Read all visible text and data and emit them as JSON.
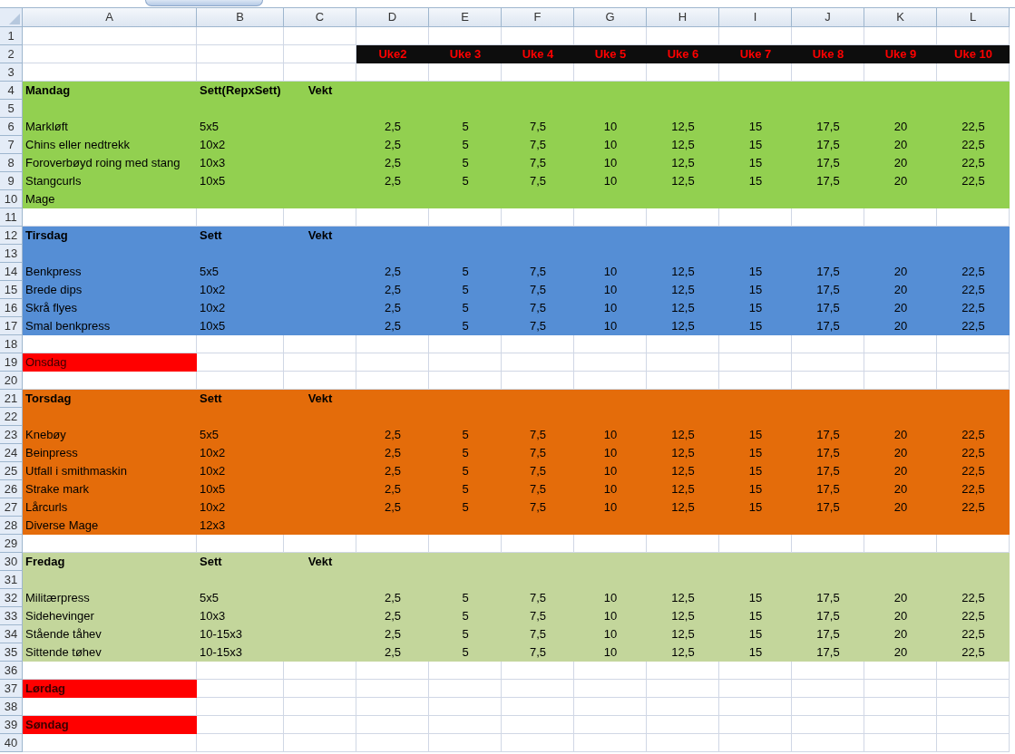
{
  "columns": [
    "A",
    "B",
    "C",
    "D",
    "E",
    "F",
    "G",
    "H",
    "I",
    "J",
    "K",
    "L"
  ],
  "rows": [
    {
      "number": "1",
      "kind": "plain"
    },
    {
      "number": "2",
      "kind": "week_header",
      "weeks": [
        "Uke2",
        "Uke 3",
        "Uke 4",
        "Uke 5",
        "Uke 6",
        "Uke 7",
        "Uke 8",
        "Uke 9",
        "Uke 10"
      ]
    },
    {
      "number": "3",
      "kind": "plain"
    },
    {
      "number": "4",
      "kind": "section",
      "color": "#92d050",
      "bold": true,
      "a": "Mandag",
      "b": "Sett(RepxSett)",
      "c": "Vekt"
    },
    {
      "number": "5",
      "kind": "section",
      "color": "#92d050"
    },
    {
      "number": "6",
      "kind": "section",
      "color": "#92d050",
      "bold": false,
      "a": "Markløft",
      "b": "5x5",
      "weights": [
        "2,5",
        "5",
        "7,5",
        "10",
        "12,5",
        "15",
        "17,5",
        "20",
        "22,5"
      ]
    },
    {
      "number": "7",
      "kind": "section",
      "color": "#92d050",
      "bold": false,
      "a": "Chins eller nedtrekk",
      "b": "10x2",
      "weights": [
        "2,5",
        "5",
        "7,5",
        "10",
        "12,5",
        "15",
        "17,5",
        "20",
        "22,5"
      ]
    },
    {
      "number": "8",
      "kind": "section",
      "color": "#92d050",
      "bold": false,
      "a": "Foroverbøyd roing med stang",
      "b": "10x3",
      "weights": [
        "2,5",
        "5",
        "7,5",
        "10",
        "12,5",
        "15",
        "17,5",
        "20",
        "22,5"
      ]
    },
    {
      "number": "9",
      "kind": "section",
      "color": "#92d050",
      "bold": false,
      "a": "Stangcurls",
      "b": "10x5",
      "weights": [
        "2,5",
        "5",
        "7,5",
        "10",
        "12,5",
        "15",
        "17,5",
        "20",
        "22,5"
      ]
    },
    {
      "number": "10",
      "kind": "section",
      "color": "#92d050",
      "bold": false,
      "a": "Mage"
    },
    {
      "number": "11",
      "kind": "plain"
    },
    {
      "number": "12",
      "kind": "section",
      "color": "#558ed5",
      "bold": true,
      "a": "Tirsdag",
      "b": "Sett",
      "c": "Vekt"
    },
    {
      "number": "13",
      "kind": "section",
      "color": "#558ed5"
    },
    {
      "number": "14",
      "kind": "section",
      "color": "#558ed5",
      "bold": false,
      "a": "Benkpress",
      "b": "5x5",
      "weights": [
        "2,5",
        "5",
        "7,5",
        "10",
        "12,5",
        "15",
        "17,5",
        "20",
        "22,5"
      ]
    },
    {
      "number": "15",
      "kind": "section",
      "color": "#558ed5",
      "bold": false,
      "a": "Brede dips",
      "b": "10x2",
      "weights": [
        "2,5",
        "5",
        "7,5",
        "10",
        "12,5",
        "15",
        "17,5",
        "20",
        "22,5"
      ]
    },
    {
      "number": "16",
      "kind": "section",
      "color": "#558ed5",
      "bold": false,
      "a": "Skrå flyes",
      "b": "10x2",
      "weights": [
        "2,5",
        "5",
        "7,5",
        "10",
        "12,5",
        "15",
        "17,5",
        "20",
        "22,5"
      ]
    },
    {
      "number": "17",
      "kind": "section",
      "color": "#558ed5",
      "bold": false,
      "a": "Smal benkpress",
      "b": "10x5",
      "weights": [
        "2,5",
        "5",
        "7,5",
        "10",
        "12,5",
        "15",
        "17,5",
        "20",
        "22,5"
      ]
    },
    {
      "number": "18",
      "kind": "plain"
    },
    {
      "number": "19",
      "kind": "day_marker",
      "color": "#ff0000",
      "bold": false,
      "a": "Onsdag"
    },
    {
      "number": "20",
      "kind": "plain"
    },
    {
      "number": "21",
      "kind": "section",
      "color": "#e46c0a",
      "bold": true,
      "a": "Torsdag",
      "b": "Sett",
      "c": "Vekt"
    },
    {
      "number": "22",
      "kind": "section",
      "color": "#e46c0a"
    },
    {
      "number": "23",
      "kind": "section",
      "color": "#e46c0a",
      "bold": false,
      "a": "Knebøy",
      "b": "5x5",
      "weights": [
        "2,5",
        "5",
        "7,5",
        "10",
        "12,5",
        "15",
        "17,5",
        "20",
        "22,5"
      ]
    },
    {
      "number": "24",
      "kind": "section",
      "color": "#e46c0a",
      "bold": false,
      "a": "Beinpress",
      "b": "10x2",
      "weights": [
        "2,5",
        "5",
        "7,5",
        "10",
        "12,5",
        "15",
        "17,5",
        "20",
        "22,5"
      ]
    },
    {
      "number": "25",
      "kind": "section",
      "color": "#e46c0a",
      "bold": false,
      "a": "Utfall i smithmaskin",
      "b": "10x2",
      "weights": [
        "2,5",
        "5",
        "7,5",
        "10",
        "12,5",
        "15",
        "17,5",
        "20",
        "22,5"
      ]
    },
    {
      "number": "26",
      "kind": "section",
      "color": "#e46c0a",
      "bold": false,
      "a": "Strake mark",
      "b": "10x5",
      "weights": [
        "2,5",
        "5",
        "7,5",
        "10",
        "12,5",
        "15",
        "17,5",
        "20",
        "22,5"
      ]
    },
    {
      "number": "27",
      "kind": "section",
      "color": "#e46c0a",
      "bold": false,
      "a": "Lårcurls",
      "b": "10x2",
      "weights": [
        "2,5",
        "5",
        "7,5",
        "10",
        "12,5",
        "15",
        "17,5",
        "20",
        "22,5"
      ]
    },
    {
      "number": "28",
      "kind": "section",
      "color": "#e46c0a",
      "bold": false,
      "a": "Diverse Mage",
      "b": "12x3"
    },
    {
      "number": "29",
      "kind": "plain"
    },
    {
      "number": "30",
      "kind": "section",
      "color": "#c3d69b",
      "bold": true,
      "a": "Fredag",
      "b": "Sett",
      "c": "Vekt"
    },
    {
      "number": "31",
      "kind": "section",
      "color": "#c3d69b"
    },
    {
      "number": "32",
      "kind": "section",
      "color": "#c3d69b",
      "bold": false,
      "a": "Militærpress",
      "b": "5x5",
      "weights": [
        "2,5",
        "5",
        "7,5",
        "10",
        "12,5",
        "15",
        "17,5",
        "20",
        "22,5"
      ]
    },
    {
      "number": "33",
      "kind": "section",
      "color": "#c3d69b",
      "bold": false,
      "a": "Sidehevinger",
      "b": "10x3",
      "weights": [
        "2,5",
        "5",
        "7,5",
        "10",
        "12,5",
        "15",
        "17,5",
        "20",
        "22,5"
      ]
    },
    {
      "number": "34",
      "kind": "section",
      "color": "#c3d69b",
      "bold": false,
      "a": "Stående tåhev",
      "b": "10-15x3",
      "weights": [
        "2,5",
        "5",
        "7,5",
        "10",
        "12,5",
        "15",
        "17,5",
        "20",
        "22,5"
      ]
    },
    {
      "number": "35",
      "kind": "section",
      "color": "#c3d69b",
      "bold": false,
      "a": "Sittende tøhev",
      "b": "10-15x3",
      "weights": [
        "2,5",
        "5",
        "7,5",
        "10",
        "12,5",
        "15",
        "17,5",
        "20",
        "22,5"
      ]
    },
    {
      "number": "36",
      "kind": "plain"
    },
    {
      "number": "37",
      "kind": "day_marker",
      "color": "#ff0000",
      "bold": true,
      "a": "Lørdag"
    },
    {
      "number": "38",
      "kind": "plain"
    },
    {
      "number": "39",
      "kind": "day_marker",
      "color": "#ff0000",
      "bold": true,
      "a": "Søndag"
    },
    {
      "number": "40",
      "kind": "plain"
    }
  ]
}
